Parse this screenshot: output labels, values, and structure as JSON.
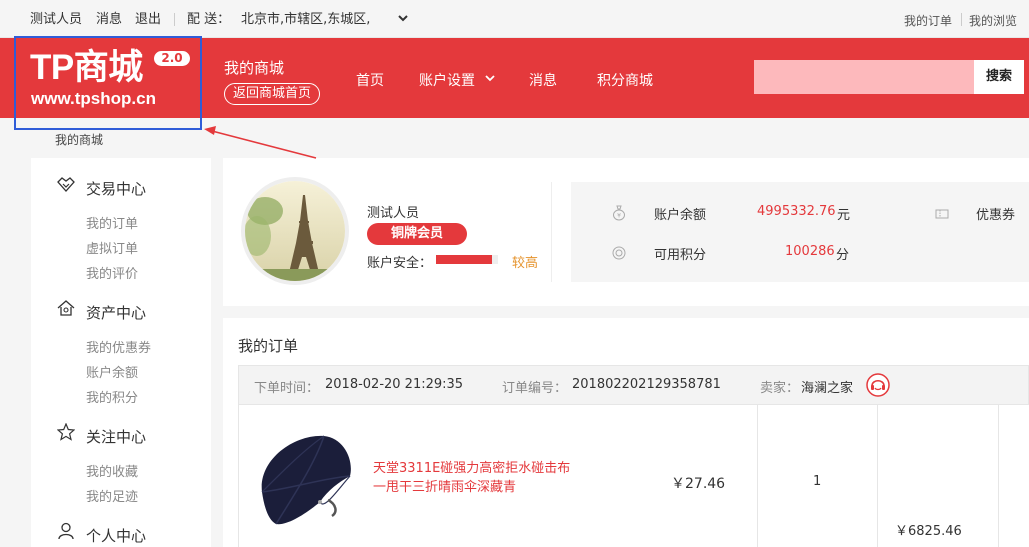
{
  "topbar": {
    "user": "测试人员",
    "messages": "消息",
    "logout": "退出",
    "delivery_label": "配 送：",
    "delivery_area": "北京市,市辖区,东城区,",
    "my_orders": "我的订单",
    "my_browse": "我的浏览"
  },
  "header": {
    "logo_text": "TP商城",
    "logo_version": "2.0",
    "logo_url": "www.tpshop.cn",
    "my_mall": "我的商城",
    "back_home": "返回商城首页",
    "nav": [
      "首页",
      "账户设置",
      "消息",
      "积分商城"
    ],
    "search_placeholder": "",
    "search_button": "搜索"
  },
  "breadcrumb": "我的商城",
  "sidebar": {
    "sections": [
      {
        "icon": "handshake-icon",
        "title": "交易中心",
        "items": [
          "我的订单",
          "虚拟订单",
          "我的评价"
        ]
      },
      {
        "icon": "house-icon",
        "title": "资产中心",
        "items": [
          "我的优惠券",
          "账户余额",
          "我的积分"
        ]
      },
      {
        "icon": "star-icon",
        "title": "关注中心",
        "items": [
          "我的收藏",
          "我的足迹"
        ]
      },
      {
        "icon": "person-icon",
        "title": "个人中心",
        "items": []
      }
    ]
  },
  "user_card": {
    "name": "测试人员",
    "level": "铜牌会员",
    "security_label": "账户安全：",
    "security_fill": 0.9,
    "security_level": "较高",
    "balance_label": "账户余额",
    "balance_value": "4995332.76",
    "balance_unit": "元",
    "points_label": "可用积分",
    "points_value": "100286",
    "points_unit": "分",
    "coupon_label": "优惠券"
  },
  "orders": {
    "title": "我的订单",
    "order_time_label": "下单时间：",
    "order_time": "2018-02-20 21:29:35",
    "order_no_label": "订单编号：",
    "order_no": "201802202129358781",
    "seller_label": "卖家：",
    "seller": "海澜之家",
    "item": {
      "name": "天堂3311E碰强力高密拒水碰击布一甩干三折晴雨伞深藏青",
      "price": "￥27.46",
      "qty": "1",
      "total": "￥6825.46"
    }
  },
  "colors": {
    "brand_red": "#e4393c",
    "frame_blue": "#2f5cd8",
    "search_bg": "#fdb9bc"
  }
}
